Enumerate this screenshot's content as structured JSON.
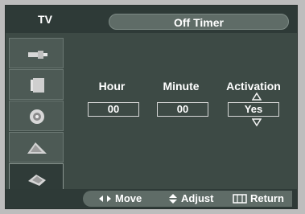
{
  "header": {
    "source_tab": "TV",
    "title": "Off Timer"
  },
  "sidebar": {
    "items": [
      {
        "name": "input-icon",
        "active": false,
        "selected": false
      },
      {
        "name": "picture-icon",
        "active": false,
        "selected": false
      },
      {
        "name": "sound-icon",
        "active": false,
        "selected": false
      },
      {
        "name": "channel-icon",
        "active": false,
        "selected": false
      },
      {
        "name": "setup-icon",
        "active": true,
        "selected": true
      }
    ]
  },
  "timer": {
    "hour_label": "Hour",
    "minute_label": "Minute",
    "activation_label": "Activation",
    "hour_value": "00",
    "minute_value": "00",
    "activation_value": "Yes"
  },
  "footer": {
    "move": "Move",
    "adjust": "Adjust",
    "return": "Return"
  },
  "colors": {
    "panel": "#3d4a45",
    "bar": "#2e3a37",
    "pill": "#5f6c67",
    "text": "#ffffff",
    "outer": "#bdbdbd"
  }
}
